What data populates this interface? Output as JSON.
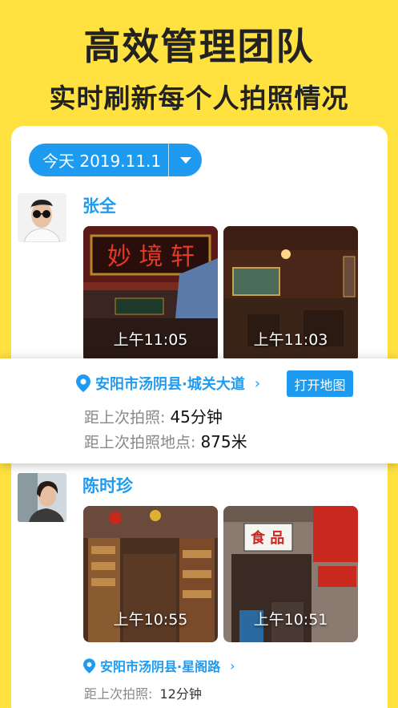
{
  "headline": "高效管理团队",
  "subline": "实时刷新每个人拍照情况",
  "date_filter": {
    "label": "今天 2019.11.1"
  },
  "people": [
    {
      "name": "张全",
      "photos": [
        {
          "time": "上午11:05"
        },
        {
          "time": "上午11:03"
        }
      ]
    },
    {
      "name": "陈时珍",
      "photos": [
        {
          "time": "上午10:55"
        },
        {
          "time": "上午10:51"
        }
      ],
      "location": "安阳市汤阴县·星阁路",
      "last_photo_label": "距上次拍照:",
      "last_photo_value": "12分钟"
    }
  ],
  "popup": {
    "location": "安阳市汤阴县·城关大道",
    "map_button": "打开地图",
    "last_photo_label": "距上次拍照:",
    "last_photo_value": "45分钟",
    "last_place_label": "距上次拍照地点:",
    "last_place_value": "875米"
  },
  "colors": {
    "background": "#FFE13F",
    "accent": "#1E9BF0"
  }
}
